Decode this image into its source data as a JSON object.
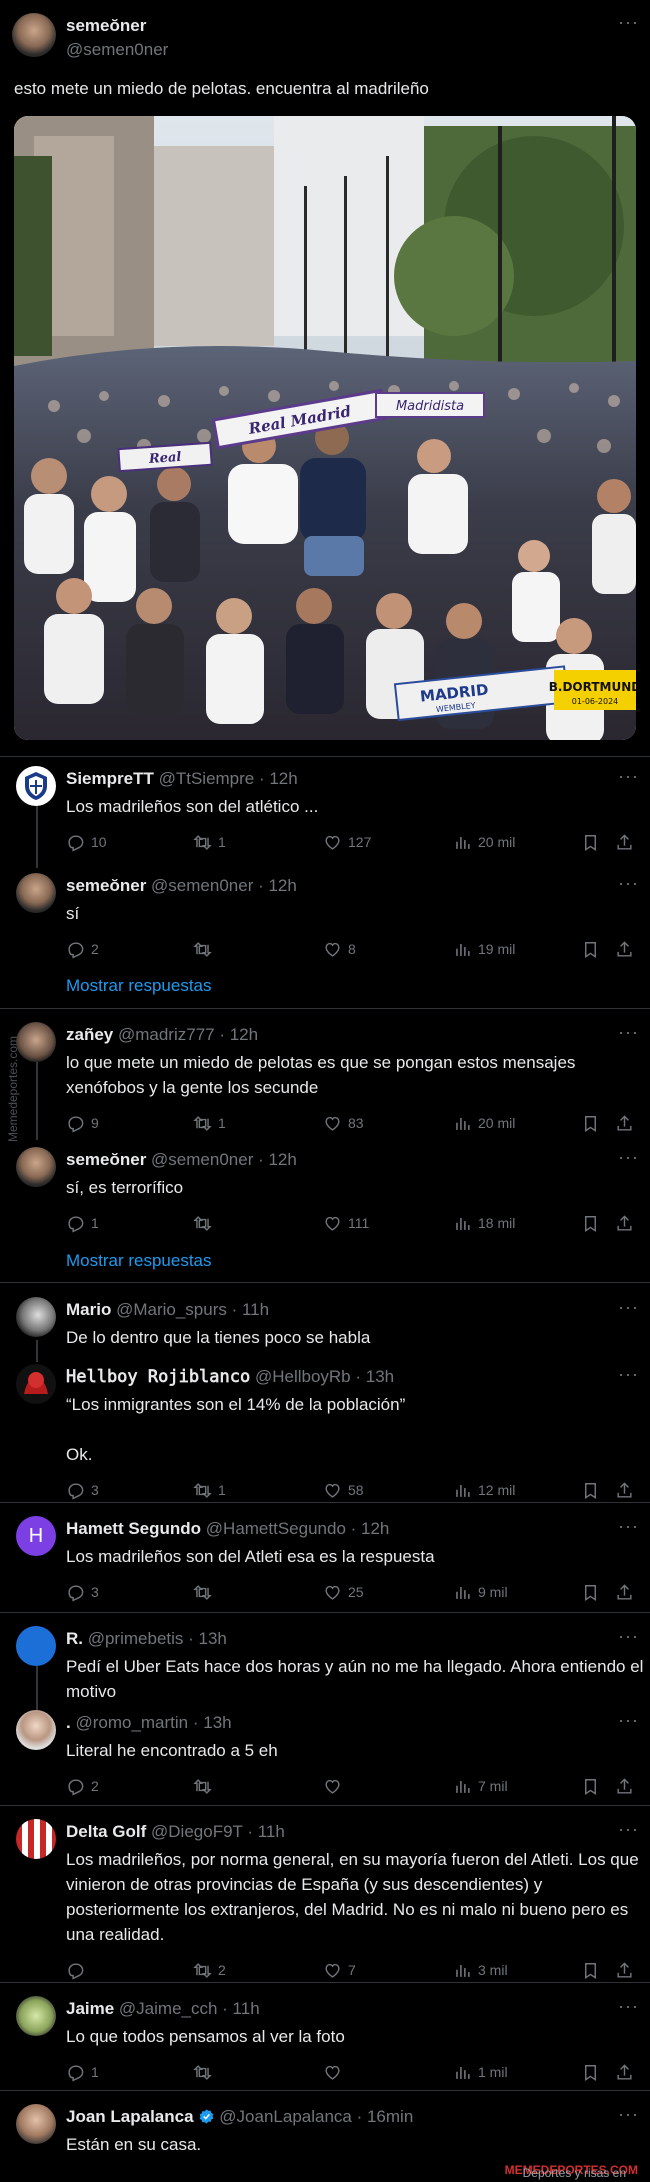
{
  "main": {
    "name": "semeŏner",
    "handle": "@semen0ner",
    "text": "esto mete un miedo de pelotas. encuentra al madrileño",
    "photo": {
      "banner_left": "Real Madrid",
      "banner_mid": "Madridista",
      "banner_small": "Real",
      "banner_bottom_left": "MADRID",
      "banner_bottom_sub": "WEMBLEY",
      "banner_bottom_right": "B.DORTMUND",
      "banner_bottom_date": "01-06-2024"
    }
  },
  "replies": [
    {
      "name": "SiempreTT",
      "meta": "@TtSiempre · 12h",
      "text": [
        "Los madrileños son del atlético ..."
      ],
      "replies": "10",
      "retweets": "1",
      "likes": "127",
      "views": "20 mil"
    },
    {
      "name": "semeŏner",
      "meta": "@semen0ner · 12h",
      "text": [
        "sí"
      ],
      "replies": "2",
      "retweets": "",
      "likes": "8",
      "views": "19 mil",
      "show_more": "Mostrar respuestas"
    },
    {
      "name": "zañey",
      "meta": "@madriz777 · 12h",
      "text": [
        "lo que mete un miedo de pelotas es que se pongan estos mensajes",
        "xenófobos y la gente los secunde"
      ],
      "replies": "9",
      "retweets": "1",
      "likes": "83",
      "views": "20 mil"
    },
    {
      "name": "semeŏner",
      "meta": "@semen0ner · 12h",
      "text": [
        "sí, es terrorífico"
      ],
      "replies": "1",
      "retweets": "",
      "likes": "111",
      "views": "18 mil",
      "show_more": "Mostrar respuestas"
    },
    {
      "name": "Mario",
      "meta": "@Mario_spurs · 11h",
      "text": [
        "De lo dentro que la tienes poco se habla"
      ]
    },
    {
      "name": "𝙷𝚎𝚕𝚕𝚋𝚘𝚢 𝚁𝚘𝚓𝚒𝚋𝚕𝚊𝚗𝚌𝚘",
      "meta": "@HellboyRb · 13h",
      "text": [
        "“Los inmigrantes son el 14% de la población”",
        "",
        "Ok."
      ],
      "replies": "3",
      "retweets": "1",
      "likes": "58",
      "views": "12 mil"
    },
    {
      "name": "Hamett Segundo",
      "meta": "@HamettSegundo · 12h",
      "text": [
        "Los madrileños son del Atleti esa es la respuesta"
      ],
      "replies": "3",
      "retweets": "",
      "likes": "25",
      "views": "9 mil",
      "avatar_letter": "H"
    },
    {
      "name": "R.",
      "meta": "@primebetis · 13h",
      "text": [
        "Pedí el Uber Eats hace dos horas y aún no me ha llegado. Ahora entiendo el",
        "motivo"
      ]
    },
    {
      "name": ".",
      "meta": "@romo_martin · 13h",
      "text": [
        "Literal he encontrado a 5 eh"
      ],
      "replies": "2",
      "retweets": "",
      "likes": "",
      "views": "7 mil"
    },
    {
      "name": "Delta Golf",
      "meta": "@DiegoF9T · 11h",
      "text": [
        "Los madrileños, por norma general, en su mayoría fueron del Atleti. Los que",
        "vinieron de otras provincias de España (y sus descendientes) y",
        "posteriormente los extranjeros, del Madrid. No es ni malo ni bueno pero es",
        "una realidad."
      ],
      "replies": "",
      "retweets": "2",
      "likes": "7",
      "views": "3 mil"
    },
    {
      "name": "Jaime",
      "meta": "@Jaime_cch · 11h",
      "text": [
        "Lo que todos pensamos al ver la foto"
      ],
      "replies": "1",
      "retweets": "",
      "likes": "",
      "views": "1 mil"
    },
    {
      "name": "Joan Lapalanca",
      "meta": "@JoanLapalanca · 16min",
      "text": [
        "Están en su casa."
      ]
    }
  ],
  "side_watermark": "Memedeportes.com",
  "footer": {
    "prefix": "Deportes y risas en ",
    "brand": "MEMEDEPORTES.COM"
  },
  "colors": {
    "background": "#000000",
    "text": "#e7e9ea",
    "muted": "#71767b",
    "link": "#1d9bf0",
    "separator": "#2f3336",
    "verified": "#1d9bf0"
  }
}
